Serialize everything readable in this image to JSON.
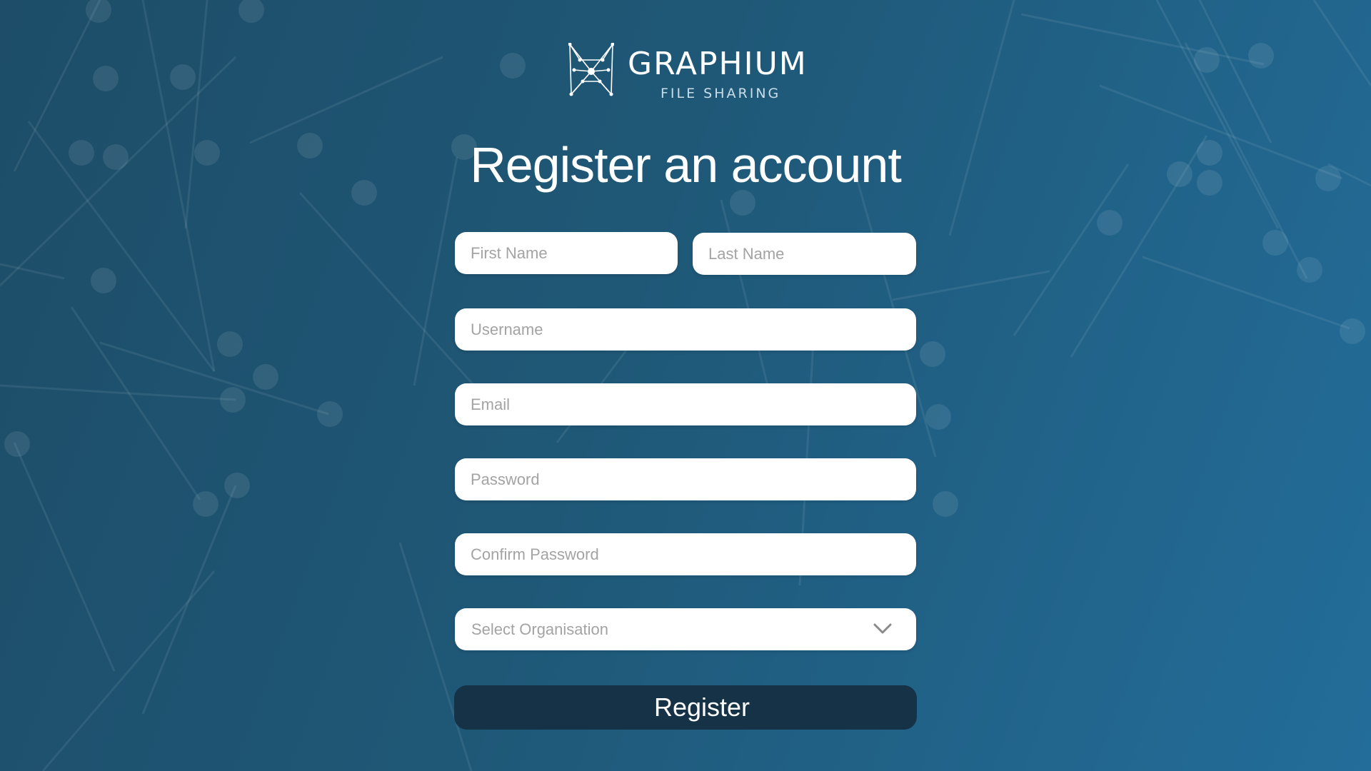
{
  "brand": {
    "name": "GRAPHIUM",
    "tagline": "FILE SHARING",
    "logo_icon": "network-butterfly-icon"
  },
  "page": {
    "title": "Register an account"
  },
  "form": {
    "first_name": {
      "placeholder": "First Name",
      "value": ""
    },
    "last_name": {
      "placeholder": "Last Name",
      "value": ""
    },
    "username": {
      "placeholder": "Username",
      "value": ""
    },
    "email": {
      "placeholder": "Email",
      "value": ""
    },
    "password": {
      "placeholder": "Password",
      "value": ""
    },
    "confirm_password": {
      "placeholder": "Confirm Password",
      "value": ""
    },
    "organisation": {
      "selected": "Select Organisation",
      "icon": "chevron-down-icon"
    },
    "submit_label": "Register"
  },
  "colors": {
    "background_start": "#1d4d68",
    "background_end": "#236d9a",
    "button": "#163246",
    "input_bg": "#ffffff",
    "placeholder": "#a3a3a3"
  }
}
